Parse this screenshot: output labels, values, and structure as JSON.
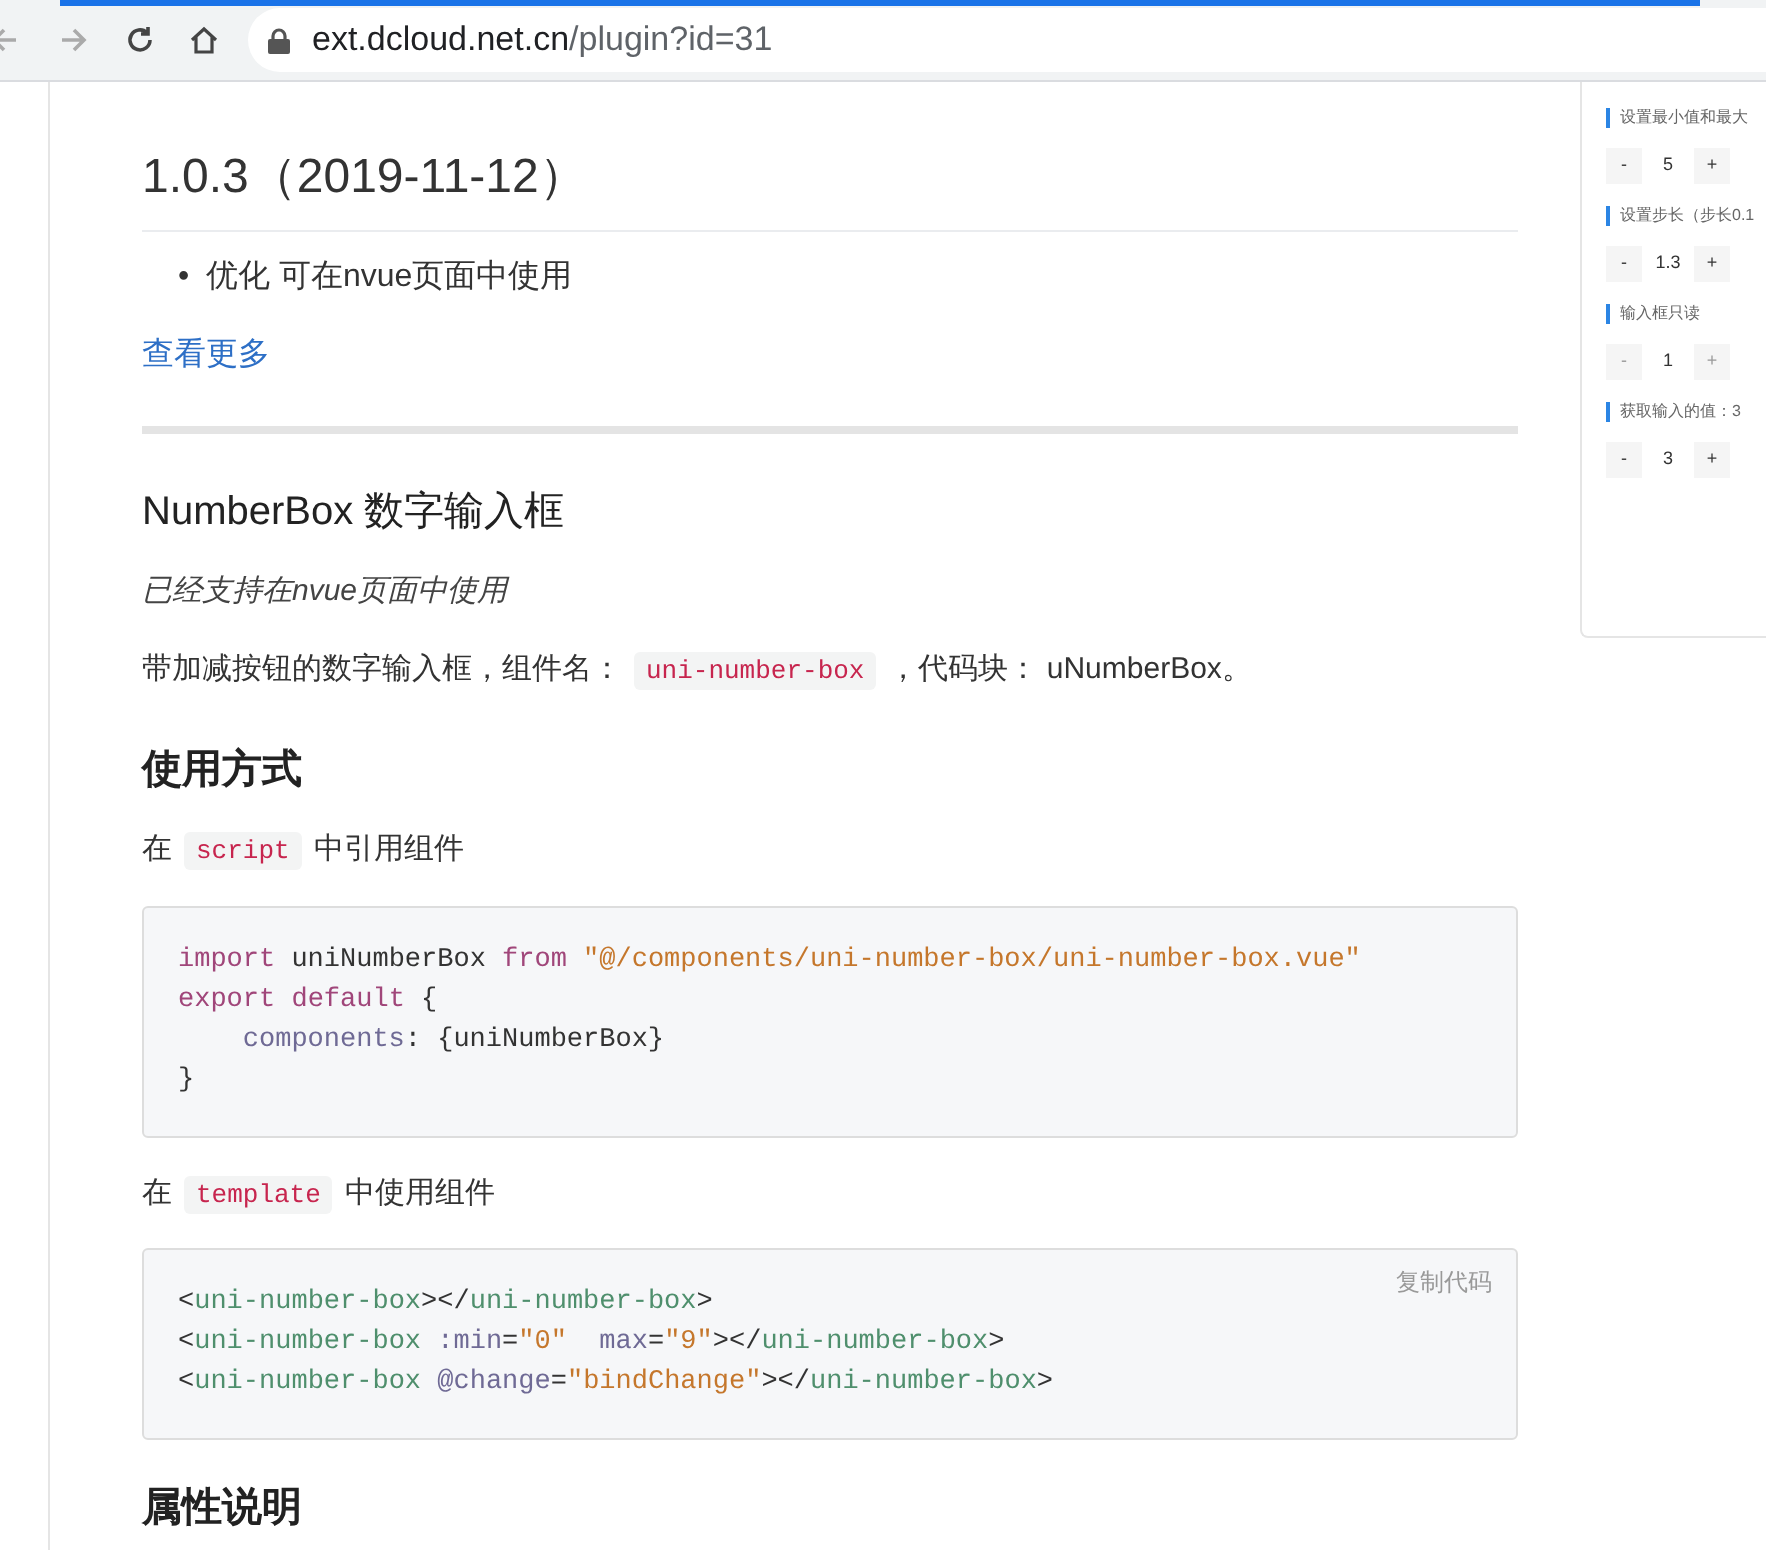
{
  "browser": {
    "url_host": "ext.dcloud.net.cn",
    "url_path": "/plugin?id=31"
  },
  "changelog": {
    "version": "1.0.3（2019-11-12）",
    "items": [
      {
        "bullet": "•",
        "text": "优化 可在nvue页面中使用"
      }
    ],
    "more_link": "查看更多"
  },
  "doc": {
    "title": "NumberBox 数字输入框",
    "note": "已经支持在nvue页面中使用",
    "intro": [
      {
        "kind": "text",
        "text": "带加减按钮的数字输入框，组件名："
      },
      {
        "kind": "code",
        "text": "uni-number-box"
      },
      {
        "kind": "text",
        "text": "，代码块： uNumberBox。"
      }
    ],
    "usage_title": "使用方式",
    "step1": [
      {
        "kind": "text",
        "text": "在"
      },
      {
        "kind": "code",
        "text": "script"
      },
      {
        "kind": "text",
        "text": "中引用组件"
      }
    ],
    "code1": {
      "lines": [
        {
          "indented": false,
          "tokens": [
            {
              "kind": "keyword",
              "text": "import"
            },
            {
              "kind": "plain",
              "text": " uniNumberBox "
            },
            {
              "kind": "keyword",
              "text": "from "
            },
            {
              "kind": "string",
              "text": "\"@/components/uni-number-box/uni-number-box.vue\""
            }
          ]
        },
        {
          "indented": false,
          "tokens": [
            {
              "kind": "keyword",
              "text": "export "
            },
            {
              "kind": "keyword",
              "text": "default"
            },
            {
              "kind": "plain",
              "text": " {"
            }
          ]
        },
        {
          "indented": true,
          "tokens": [
            {
              "kind": "attr",
              "text": "components"
            },
            {
              "kind": "plain",
              "text": ": {uniNumberBox}"
            }
          ]
        },
        {
          "indented": false,
          "tokens": [
            {
              "kind": "plain",
              "text": "}"
            }
          ]
        }
      ]
    },
    "step2": [
      {
        "kind": "text",
        "text": "在"
      },
      {
        "kind": "code",
        "text": "template"
      },
      {
        "kind": "text",
        "text": "中使用组件"
      }
    ],
    "code2": {
      "copy_label": "复制代码",
      "lines": [
        {
          "indented": false,
          "tokens": [
            {
              "kind": "plain",
              "text": "<"
            },
            {
              "kind": "tag",
              "text": "uni-number-box"
            },
            {
              "kind": "plain",
              "text": "></"
            },
            {
              "kind": "tag",
              "text": "uni-number-box"
            },
            {
              "kind": "plain",
              "text": ">"
            }
          ]
        },
        {
          "indented": false,
          "tokens": [
            {
              "kind": "plain",
              "text": "<"
            },
            {
              "kind": "tag",
              "text": "uni-number-box "
            },
            {
              "kind": "attr",
              "text": ":min"
            },
            {
              "kind": "plain",
              "text": "="
            },
            {
              "kind": "string",
              "text": "\"0\" "
            },
            {
              "kind": "attr",
              "text": " max"
            },
            {
              "kind": "plain",
              "text": "="
            },
            {
              "kind": "string",
              "text": "\"9\""
            },
            {
              "kind": "plain",
              "text": "></"
            },
            {
              "kind": "tag",
              "text": "uni-number-box"
            },
            {
              "kind": "plain",
              "text": ">"
            }
          ]
        },
        {
          "indented": false,
          "tokens": [
            {
              "kind": "plain",
              "text": "<"
            },
            {
              "kind": "tag",
              "text": "uni-number-box "
            },
            {
              "kind": "attr",
              "text": "@change"
            },
            {
              "kind": "plain",
              "text": "="
            },
            {
              "kind": "string",
              "text": "\"bindChange\""
            },
            {
              "kind": "plain",
              "text": "></"
            },
            {
              "kind": "tag",
              "text": "uni-number-box"
            },
            {
              "kind": "plain",
              "text": ">"
            }
          ]
        }
      ]
    },
    "props_title": "属性说明"
  },
  "preview": {
    "sections": [
      {
        "label": "设置最小值和最大",
        "minus": "-",
        "value": "5",
        "plus": "+",
        "disabled": false
      },
      {
        "label": "设置步长（步长0.1",
        "minus": "-",
        "value": "1.3",
        "plus": "+",
        "disabled": false
      },
      {
        "label": "输入框只读",
        "minus": "-",
        "value": "1",
        "plus": "+",
        "disabled": true
      },
      {
        "label": "获取输入的值：3",
        "minus": "-",
        "value": "3",
        "plus": "+",
        "disabled": false
      }
    ]
  }
}
